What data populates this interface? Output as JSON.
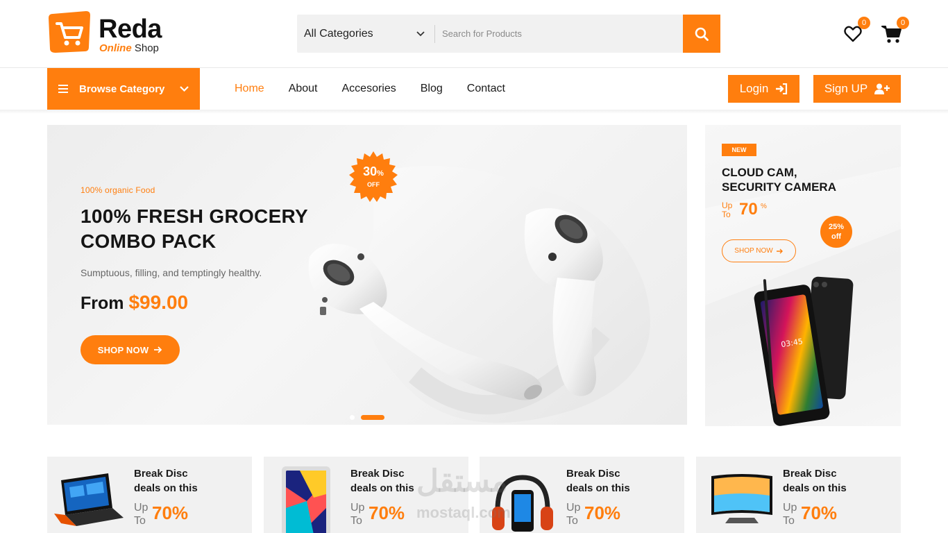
{
  "colors": {
    "accent": "#ff7e0e"
  },
  "header": {
    "logo_title": "Reda",
    "logo_sub_highlight": "Online",
    "logo_sub_rest": "Shop",
    "search_category": "All Categories",
    "search_placeholder": "Search for Products",
    "wishlist_count": "0",
    "cart_count": "0"
  },
  "nav": {
    "browse_label": "Browse Category",
    "links": [
      "Home",
      "About",
      "Accesories",
      "Blog",
      "Contact"
    ],
    "active": "Home",
    "login_label": "Login",
    "signup_label": "Sign UP"
  },
  "hero": {
    "eyebrow": "100% organic Food",
    "title_line1": "100% FRESH GROCERY",
    "title_line2": "COMBO PACK",
    "desc": "Sumptuous, filling, and temptingly healthy.",
    "price_prefix": "From",
    "price": "$99.00",
    "button": "SHOP NOW",
    "badge_pct": "30",
    "badge_pct_sign": "%",
    "badge_off": "OFF",
    "slide_active_index": 2,
    "slide_count": 2
  },
  "side_banner": {
    "tag": "NEW",
    "title_line1": "CLOUD CAM,",
    "title_line2": "SECURITY CAMERA",
    "up": "Up",
    "to": "To",
    "pct": "70",
    "pct_sign": "%",
    "off_pct": "25%",
    "off_word": "off",
    "button": "SHOP NOW"
  },
  "cards": [
    {
      "line1": "Break Disc",
      "line2": "deals on this",
      "up": "Up",
      "to": "To",
      "pct": "70%",
      "product_icon": "laptop"
    },
    {
      "line1": "Break Disc",
      "line2": "deals on this",
      "up": "Up",
      "to": "To",
      "pct": "70%",
      "product_icon": "tablet"
    },
    {
      "line1": "Break Disc",
      "line2": "deals on this",
      "up": "Up",
      "to": "To",
      "pct": "70%",
      "product_icon": "headphones"
    },
    {
      "line1": "Break Disc",
      "line2": "deals on this",
      "up": "Up",
      "to": "To",
      "pct": "70%",
      "product_icon": "tv"
    }
  ],
  "watermark": {
    "arabic": "مستقل",
    "latin": "mostaql.com"
  }
}
